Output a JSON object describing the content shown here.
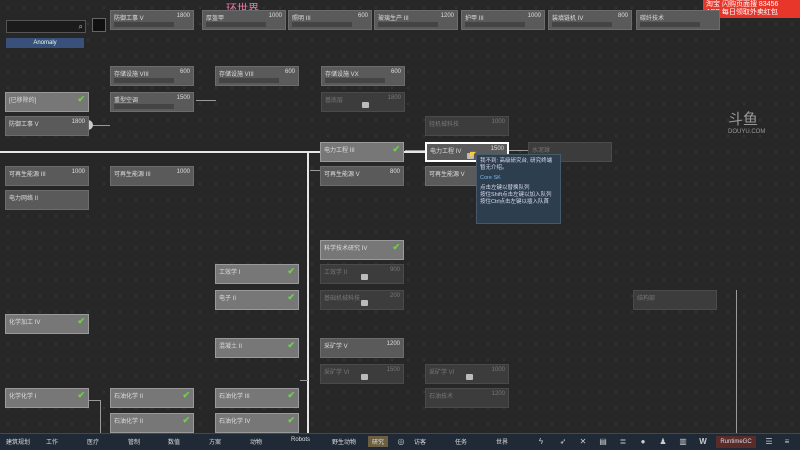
{
  "search": {
    "placeholder": ""
  },
  "tabs": {
    "anomaly": "Anomaly"
  },
  "watermark_tl": "环世界",
  "ad": {
    "line1": "淘宝 闪购页面搜 83456",
    "line2": "APP 每日领取外卖红包"
  },
  "douyu": {
    "logo": "斗鱼",
    "url": "DOUYU.COM"
  },
  "nodes": {
    "n1": {
      "title": "防御工事 V",
      "cost": "1800"
    },
    "n2": {
      "title": "厚盔甲",
      "cost": "1000"
    },
    "n3": {
      "title": "照明 III",
      "cost": "600"
    },
    "n4": {
      "title": "玻璃生产 III",
      "cost": "1200"
    },
    "n5": {
      "title": "护甲 III",
      "cost": "1000"
    },
    "n6": {
      "title": "装填链机 IV",
      "cost": "800"
    },
    "n7": {
      "title": "碳纤技术",
      "cost": ""
    },
    "n8": {
      "title": "存储设施 VIII",
      "cost": "600"
    },
    "n9": {
      "title": "存储设施 VIII",
      "cost": "600"
    },
    "n10": {
      "title": "存储设施 VX",
      "cost": "600"
    },
    "n11": {
      "title": "基底层",
      "cost": "1800"
    },
    "n12": {
      "title": "重型空调",
      "cost": "1500"
    },
    "n13": {
      "title": "可再生能源 III",
      "cost": "1000"
    },
    "n14": {
      "title": "电力工程 III",
      "cost": ""
    },
    "n15": {
      "title": "电力工程 IV",
      "cost": "1500"
    },
    "n16": {
      "title": "可再生能源 III",
      "cost": "1000"
    },
    "n17": {
      "title": "可再生能源 V",
      "cost": "800"
    },
    "n18": {
      "title": "可再生能源 V",
      "cost": ""
    },
    "n19": {
      "title": "电力网络 II",
      "cost": ""
    },
    "n20": {
      "title": "科学技术研究 IV",
      "cost": ""
    },
    "n21": {
      "title": "工效学 I",
      "cost": ""
    },
    "n22": {
      "title": "电子 II",
      "cost": ""
    },
    "n23": {
      "title": "工效学 II",
      "cost": "900"
    },
    "n24": {
      "title": "基础机械科技",
      "cost": "200"
    },
    "n25": {
      "title": "化学加工 IV",
      "cost": ""
    },
    "n26": {
      "title": "混凝土 II",
      "cost": ""
    },
    "n27": {
      "title": "采矿学 V",
      "cost": "1200"
    },
    "n28": {
      "title": "采矿学 VI",
      "cost": "1500"
    },
    "n29": {
      "title": "采矿学 VI",
      "cost": "1000"
    },
    "n30": {
      "title": "化学化学 I",
      "cost": ""
    },
    "n31": {
      "title": "石油化学 II",
      "cost": ""
    },
    "n32": {
      "title": "石油化学 III",
      "cost": ""
    },
    "n33": {
      "title": "石油技术",
      "cost": "1200"
    },
    "n34": {
      "title": "石油技术",
      "cost": ""
    },
    "n35": {
      "title": "石油化学 IV",
      "cost": ""
    },
    "n36": {
      "title": "轻机械科技",
      "cost": "1000"
    },
    "n37": {
      "title": "防御工事 V",
      "cost": "1800"
    },
    "n38": {
      "title": "[已移除的]",
      "cost": ""
    },
    "n39": {
      "title": "石油化学 II",
      "cost": ""
    },
    "n40": {
      "title": "结构部",
      "cost": ""
    },
    "n41": {
      "title": "水泥球",
      "cost": ""
    }
  },
  "tooltip": {
    "l1": "我不到: 高级研究台, 研究终端",
    "l2": "暂无介绍。",
    "core": "Core SK",
    "l4": "点击左键以替换队列",
    "l5": "按住Shift点击左键以加入队列",
    "l6": "按住Ctrl点击左键以插入队首"
  },
  "bottom": {
    "b1": "建筑规划",
    "b2": "工作",
    "b3": "医疗",
    "b4": "管制",
    "b5": "数值",
    "b6": "方案",
    "b7": "动物",
    "b8": "Robots",
    "b9": "野生动物",
    "b10": "研究",
    "b11": "访客",
    "b12": "任务",
    "b13": "世界",
    "gc": "RuntimeGC"
  }
}
